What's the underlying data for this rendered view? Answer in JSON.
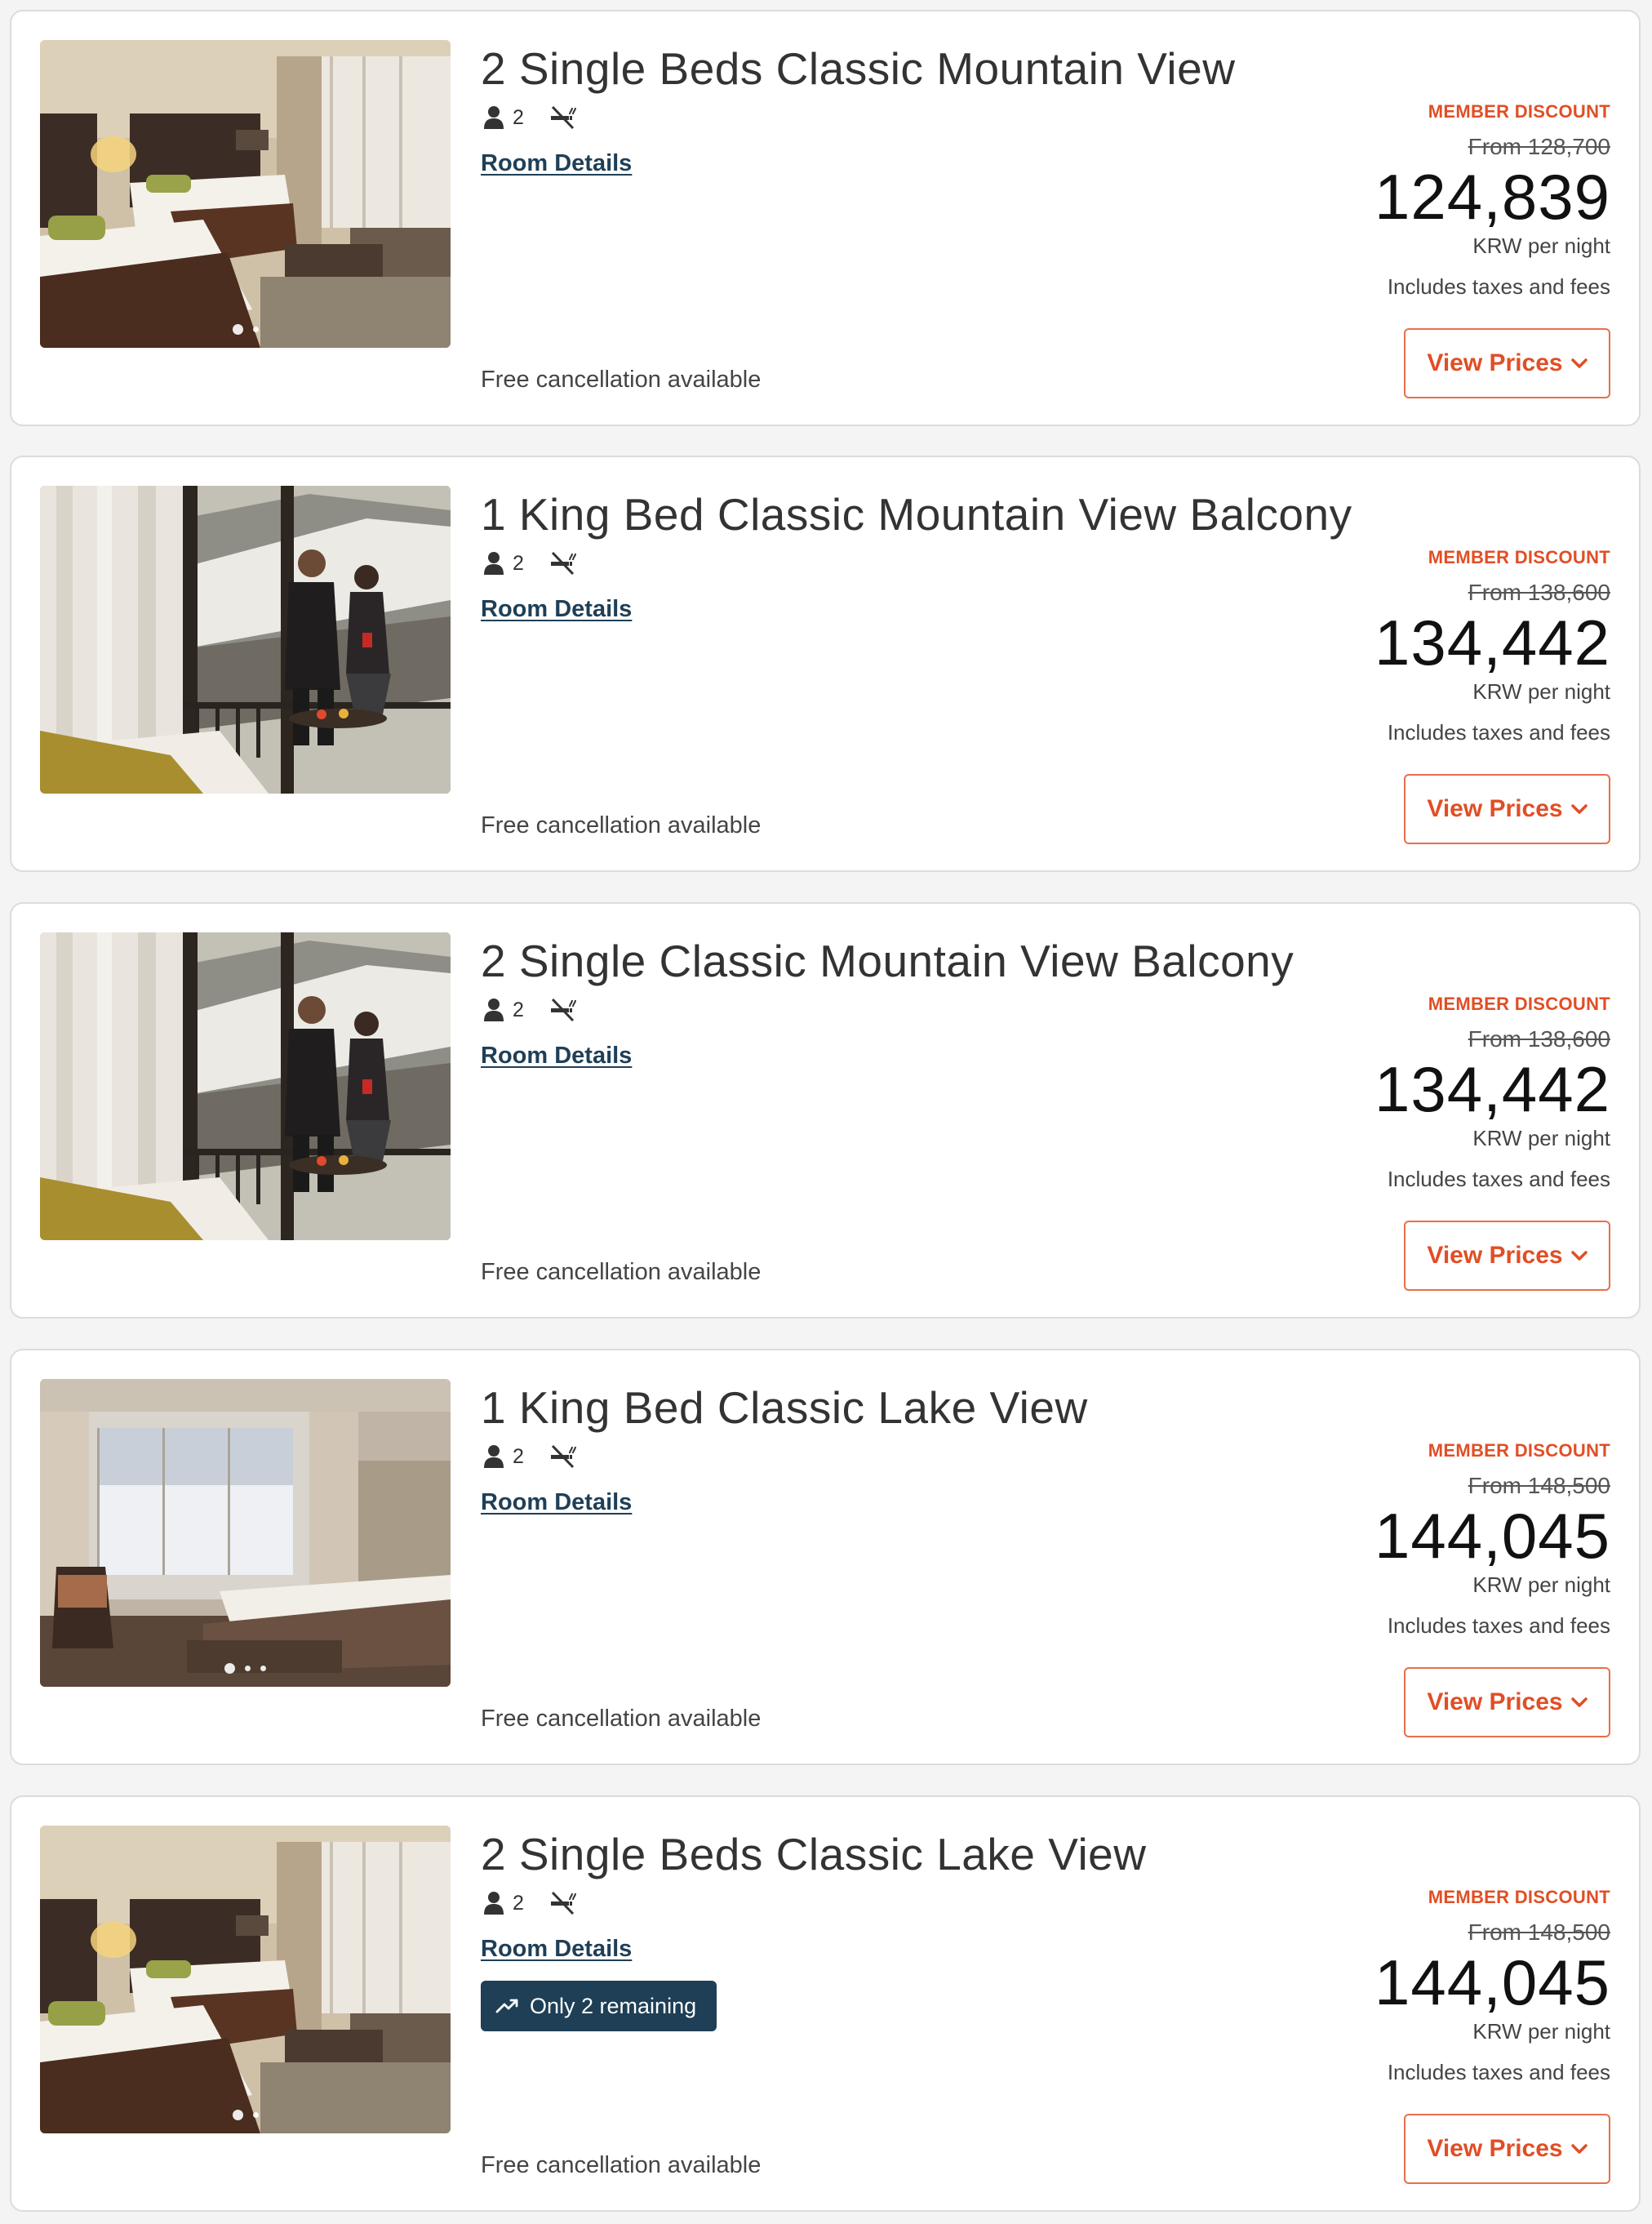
{
  "rooms": [
    {
      "title": "2 Single Beds Classic Mountain View",
      "guests": "2",
      "photo": "twin-bedroom",
      "photo_dots": 2,
      "room_details_label": "Room Details",
      "badge": "",
      "member_label": "MEMBER DISCOUNT",
      "from_price": "From 128,700",
      "price": "124,839",
      "per_night": "KRW per night",
      "taxes": "Includes taxes and fees",
      "cancellation": "Free cancellation available",
      "view_prices_label": "View Prices"
    },
    {
      "title": "1 King Bed Classic Mountain View Balcony",
      "guests": "2",
      "photo": "balcony-couple",
      "photo_dots": 0,
      "room_details_label": "Room Details",
      "badge": "",
      "member_label": "MEMBER DISCOUNT",
      "from_price": "From 138,600",
      "price": "134,442",
      "per_night": "KRW per night",
      "taxes": "Includes taxes and fees",
      "cancellation": "Free cancellation available",
      "view_prices_label": "View Prices"
    },
    {
      "title": "2 Single Classic Mountain View Balcony",
      "guests": "2",
      "photo": "balcony-couple",
      "photo_dots": 0,
      "room_details_label": "Room Details",
      "badge": "",
      "member_label": "MEMBER DISCOUNT",
      "from_price": "From 138,600",
      "price": "134,442",
      "per_night": "KRW per night",
      "taxes": "Includes taxes and fees",
      "cancellation": "Free cancellation available",
      "view_prices_label": "View Prices"
    },
    {
      "title": "1 King Bed Classic Lake View",
      "guests": "2",
      "photo": "king-bedroom",
      "photo_dots": 3,
      "room_details_label": "Room Details",
      "badge": "",
      "member_label": "MEMBER DISCOUNT",
      "from_price": "From 148,500",
      "price": "144,045",
      "per_night": "KRW per night",
      "taxes": "Includes taxes and fees",
      "cancellation": "Free cancellation available",
      "view_prices_label": "View Prices"
    },
    {
      "title": "2 Single Beds Classic Lake View",
      "guests": "2",
      "photo": "twin-bedroom",
      "photo_dots": 2,
      "room_details_label": "Room Details",
      "badge": "Only 2 remaining",
      "member_label": "MEMBER DISCOUNT",
      "from_price": "From 148,500",
      "price": "144,045",
      "per_night": "KRW per night",
      "taxes": "Includes taxes and fees",
      "cancellation": "Free cancellation available",
      "view_prices_label": "View Prices"
    }
  ],
  "icons": {
    "guests": "person-icon",
    "smoking": "no-smoking-icon",
    "badge": "trending-up-icon",
    "button": "chevron-down-icon"
  },
  "colors": {
    "accent": "#e14e25",
    "badge_bg": "#1e3f55",
    "link": "#1f3f57"
  }
}
